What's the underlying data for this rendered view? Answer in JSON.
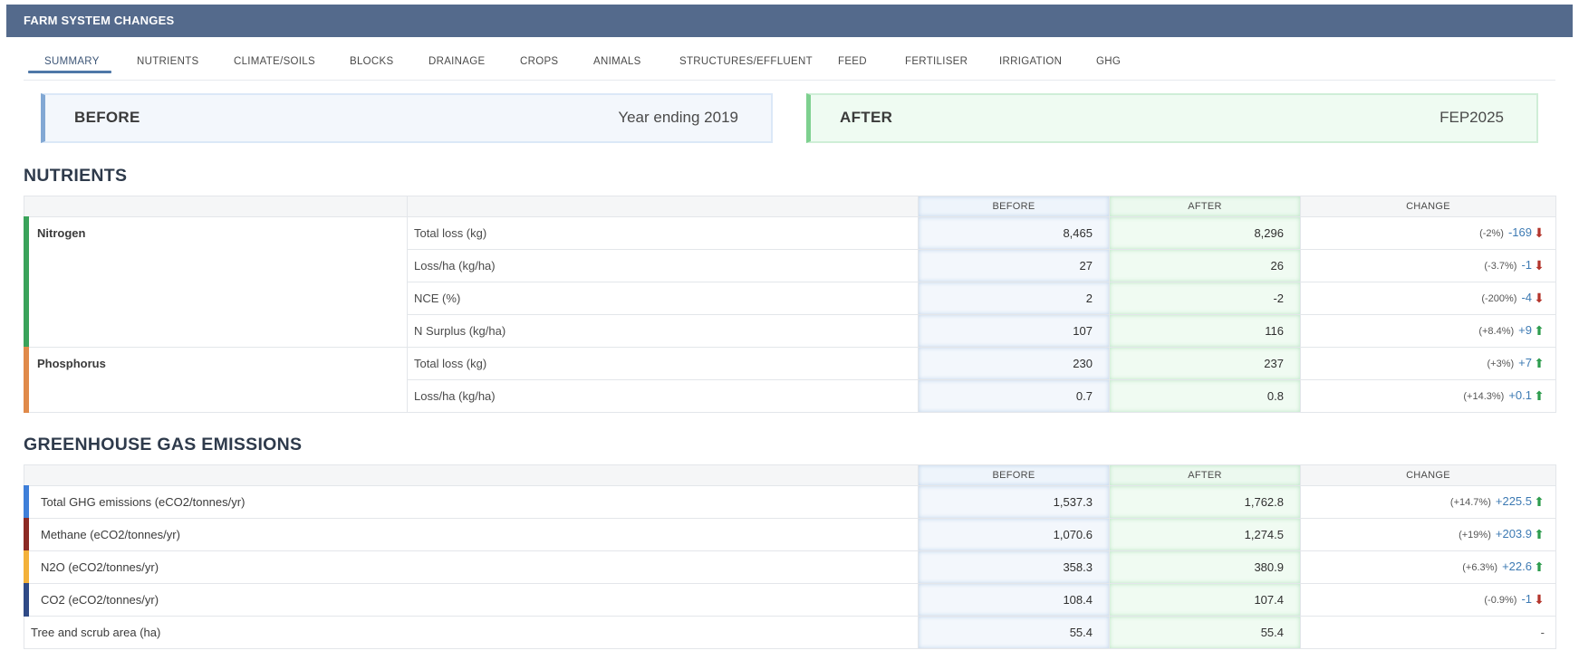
{
  "header": {
    "title": "FARM SYSTEM CHANGES"
  },
  "tabs": [
    {
      "label": "SUMMARY"
    },
    {
      "label": "NUTRIENTS"
    },
    {
      "label": "CLIMATE/SOILS"
    },
    {
      "label": "BLOCKS"
    },
    {
      "label": "DRAINAGE"
    },
    {
      "label": "CROPS"
    },
    {
      "label": "ANIMALS"
    },
    {
      "label": "STRUCTURES/EFFLUENT"
    },
    {
      "label": "FEED"
    },
    {
      "label": "FERTILISER"
    },
    {
      "label": "IRRIGATION"
    },
    {
      "label": "GHG"
    }
  ],
  "before": {
    "label": "BEFORE",
    "value": "Year ending 2019"
  },
  "after": {
    "label": "AFTER",
    "value": "FEP2025"
  },
  "nutrients": {
    "title": "NUTRIENTS",
    "headers": {
      "before": "BEFORE",
      "after": "AFTER",
      "change": "CHANGE"
    },
    "groups": [
      {
        "name": "Nitrogen",
        "color": "#3aa35a",
        "rows": [
          {
            "metric": "Total loss (kg)",
            "before": "8,465",
            "after": "8,296",
            "pct": "(-2%)",
            "delta": "-169",
            "dir": "down"
          },
          {
            "metric": "Loss/ha (kg/ha)",
            "before": "27",
            "after": "26",
            "pct": "(-3.7%)",
            "delta": "-1",
            "dir": "down"
          },
          {
            "metric": "NCE (%)",
            "before": "2",
            "after": "-2",
            "pct": "(-200%)",
            "delta": "-4",
            "dir": "down"
          },
          {
            "metric": "N Surplus (kg/ha)",
            "before": "107",
            "after": "116",
            "pct": "(+8.4%)",
            "delta": "+9",
            "dir": "up"
          }
        ]
      },
      {
        "name": "Phosphorus",
        "color": "#e08a4a",
        "rows": [
          {
            "metric": "Total loss (kg)",
            "before": "230",
            "after": "237",
            "pct": "(+3%)",
            "delta": "+7",
            "dir": "up"
          },
          {
            "metric": "Loss/ha (kg/ha)",
            "before": "0.7",
            "after": "0.8",
            "pct": "(+14.3%)",
            "delta": "+0.1",
            "dir": "up"
          }
        ]
      }
    ]
  },
  "ghg": {
    "title": "GREENHOUSE GAS EMISSIONS",
    "headers": {
      "before": "BEFORE",
      "after": "AFTER",
      "change": "CHANGE"
    },
    "rows": [
      {
        "name": "Total GHG emissions (eCO2/tonnes/yr)",
        "color": "#3f7fd9",
        "before": "1,537.3",
        "after": "1,762.8",
        "pct": "(+14.7%)",
        "delta": "+225.5",
        "dir": "up"
      },
      {
        "name": "Methane (eCO2/tonnes/yr)",
        "color": "#8c2a24",
        "before": "1,070.6",
        "after": "1,274.5",
        "pct": "(+19%)",
        "delta": "+203.9",
        "dir": "up"
      },
      {
        "name": "N2O (eCO2/tonnes/yr)",
        "color": "#f3b13a",
        "before": "358.3",
        "after": "380.9",
        "pct": "(+6.3%)",
        "delta": "+22.6",
        "dir": "up"
      },
      {
        "name": "CO2 (eCO2/tonnes/yr)",
        "color": "#2f4a86",
        "before": "108.4",
        "after": "107.4",
        "pct": "(-0.9%)",
        "delta": "-1",
        "dir": "down"
      }
    ],
    "tree": {
      "name": "Tree and scrub area (ha)",
      "before": "55.4",
      "after": "55.4",
      "change": "-"
    }
  },
  "icons": {
    "up": "arrow-up-icon",
    "down": "arrow-down-icon"
  }
}
